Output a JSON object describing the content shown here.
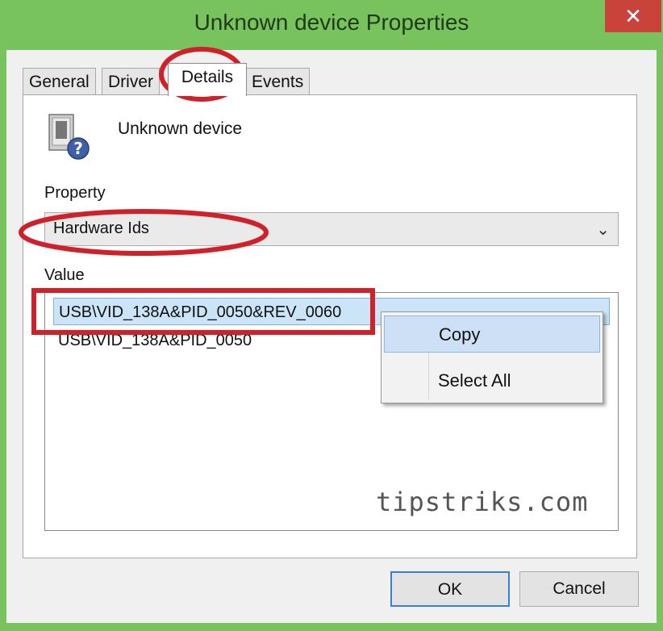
{
  "window": {
    "title": "Unknown device Properties",
    "close_glyph": "✕"
  },
  "tabs": [
    {
      "label": "General"
    },
    {
      "label": "Driver"
    },
    {
      "label": "Details"
    },
    {
      "label": "Events"
    }
  ],
  "device": {
    "name": "Unknown device",
    "icon": "unknown-device-icon"
  },
  "property": {
    "label": "Property",
    "selected": "Hardware Ids",
    "arrow_glyph": "⌄"
  },
  "value": {
    "label": "Value",
    "items": [
      "USB\\VID_138A&PID_0050&REV_0060",
      "USB\\VID_138A&PID_0050"
    ]
  },
  "context_menu": {
    "items": [
      "Copy",
      "Select All"
    ]
  },
  "watermark": "tipstriks.com",
  "buttons": {
    "ok": "OK",
    "cancel": "Cancel"
  },
  "colors": {
    "annotation": "#d0202a",
    "selection": "#cce4f7",
    "title_bar": "#79c35e",
    "close_button": "#c9433a"
  }
}
